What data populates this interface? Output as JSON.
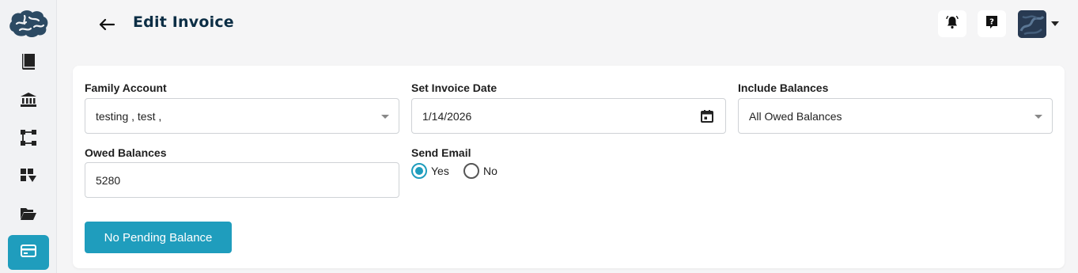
{
  "app": {
    "brand_color": "#1f9dbd",
    "title_color": "#0c2e45"
  },
  "sidebar": {
    "items": [
      {
        "icon": "book-icon",
        "active": false
      },
      {
        "icon": "bank-icon",
        "active": false
      },
      {
        "icon": "flow-icon",
        "active": false
      },
      {
        "icon": "grid-filter-icon",
        "active": false
      },
      {
        "icon": "folder-open-icon",
        "active": false
      },
      {
        "icon": "credit-card-icon",
        "active": true
      }
    ]
  },
  "header": {
    "title": "Edit Invoice",
    "back_icon": "arrow-left-icon",
    "notification_icon": "bell-icon",
    "help_icon": "help-icon"
  },
  "form": {
    "family_account": {
      "label": "Family Account",
      "value": "testing , test ,"
    },
    "invoice_date": {
      "label": "Set Invoice Date",
      "value": "1/14/2026"
    },
    "include_balances": {
      "label": "Include Balances",
      "value": "All Owed Balances"
    },
    "owed_balances": {
      "label": "Owed Balances",
      "value": "5280"
    },
    "send_email": {
      "label": "Send Email",
      "options": [
        {
          "label": "Yes",
          "selected": true
        },
        {
          "label": "No",
          "selected": false
        }
      ]
    },
    "submit_label": "No Pending Balance"
  }
}
